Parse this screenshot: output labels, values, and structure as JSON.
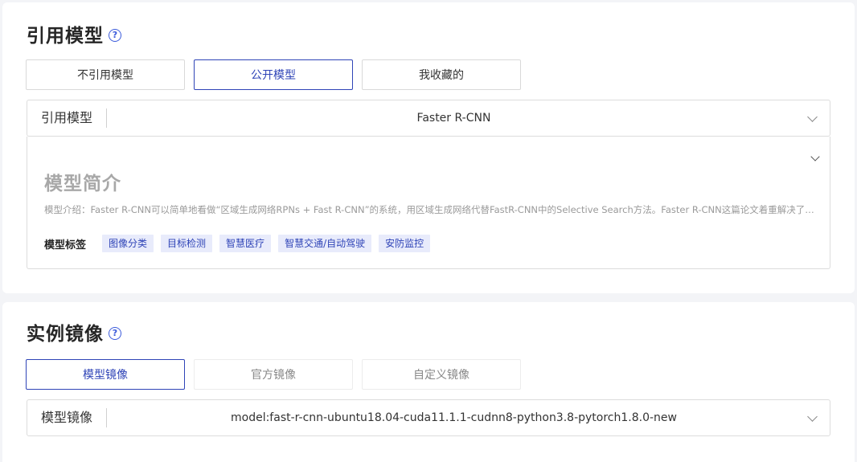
{
  "reference_section": {
    "title": "引用模型",
    "tabs": [
      {
        "label": "不引用模型",
        "state": "normal"
      },
      {
        "label": "公开模型",
        "state": "active"
      },
      {
        "label": "我收藏的",
        "state": "normal"
      }
    ],
    "select": {
      "label": "引用模型",
      "value": "Faster R-CNN"
    },
    "intro": {
      "title": "模型简介",
      "description": "模型介绍：Faster R-CNN可以简单地看做“区域生成网络RPNs + Fast R-CNN”的系统，用区域生成网络代替FastR-CNN中的Selective Search方法。Faster R-CNN这篇论文着重解决了这个系统中的三个问题",
      "tags_label": "模型标签",
      "tags": [
        "图像分类",
        "目标检测",
        "智慧医疗",
        "智慧交通/自动驾驶",
        "安防监控"
      ]
    }
  },
  "image_section": {
    "title": "实例镜像",
    "tabs": [
      {
        "label": "模型镜像",
        "state": "active"
      },
      {
        "label": "官方镜像",
        "state": "disabled"
      },
      {
        "label": "自定义镜像",
        "state": "disabled"
      }
    ],
    "select": {
      "label": "模型镜像",
      "value": "model:fast-r-cnn-ubuntu18.04-cuda11.1.1-cudnn8-python3.8-pytorch1.8.0-new"
    }
  },
  "colors": {
    "accent": "#2f44b7",
    "tag_background": "#e8ebfb",
    "page_background": "#f3f4f7"
  },
  "icons": {
    "help": "question-circle-icon",
    "dropdown": "chevron-down-icon"
  }
}
